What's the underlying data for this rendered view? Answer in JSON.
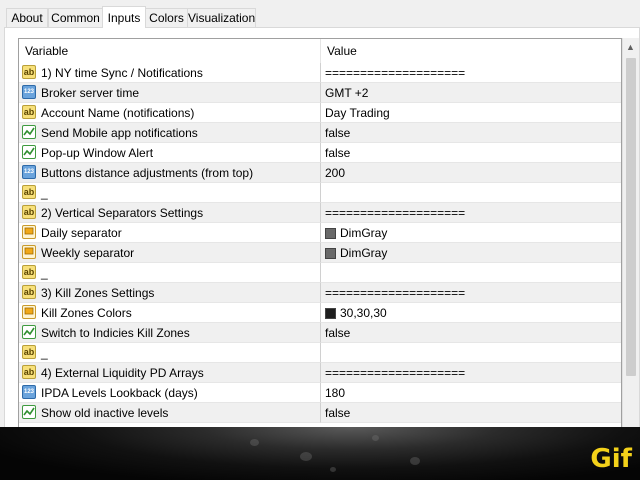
{
  "tabs": [
    {
      "label": "About",
      "active": false
    },
    {
      "label": "Common",
      "active": false
    },
    {
      "label": "Inputs",
      "active": true
    },
    {
      "label": "Colors",
      "active": false
    },
    {
      "label": "Visualization",
      "active": false
    }
  ],
  "grid": {
    "header_variable": "Variable",
    "header_value": "Value",
    "rows": [
      {
        "type": "ab",
        "label": "1) NY time Sync / Notifications",
        "value": "===================="
      },
      {
        "type": "num",
        "label": "Broker server time",
        "value": "GMT +2"
      },
      {
        "type": "ab",
        "label": "Account Name (notifications)",
        "value": "Day Trading"
      },
      {
        "type": "bool",
        "label": "Send Mobile app notifications",
        "value": "false"
      },
      {
        "type": "bool",
        "label": "Pop-up Window Alert",
        "value": "false"
      },
      {
        "type": "num",
        "label": "Buttons distance adjustments (from top)",
        "value": "200"
      },
      {
        "type": "ab",
        "label": "_",
        "value": ""
      },
      {
        "type": "ab",
        "label": "2) Vertical Separators Settings",
        "value": "===================="
      },
      {
        "type": "color",
        "label": "Daily separator",
        "value": "DimGray",
        "swatch": "#696969"
      },
      {
        "type": "color",
        "label": "Weekly separator",
        "value": "DimGray",
        "swatch": "#696969"
      },
      {
        "type": "ab",
        "label": "_",
        "value": ""
      },
      {
        "type": "ab",
        "label": "3) Kill Zones Settings",
        "value": "===================="
      },
      {
        "type": "color",
        "label": "Kill Zones Colors",
        "value": "30,30,30",
        "swatch": "#1e1e1e"
      },
      {
        "type": "bool",
        "label": "Switch to Indicies Kill Zones",
        "value": "false"
      },
      {
        "type": "ab",
        "label": "_",
        "value": ""
      },
      {
        "type": "ab",
        "label": "4) External Liquidity PD Arrays",
        "value": "===================="
      },
      {
        "type": "num",
        "label": "IPDA Levels Lookback (days)",
        "value": "180"
      },
      {
        "type": "bool",
        "label": "Show old inactive levels",
        "value": "false"
      }
    ]
  },
  "badge": {
    "label": "Gif",
    "color": "#f3d11a"
  },
  "icons": {
    "ab": "ab",
    "num": "123"
  }
}
